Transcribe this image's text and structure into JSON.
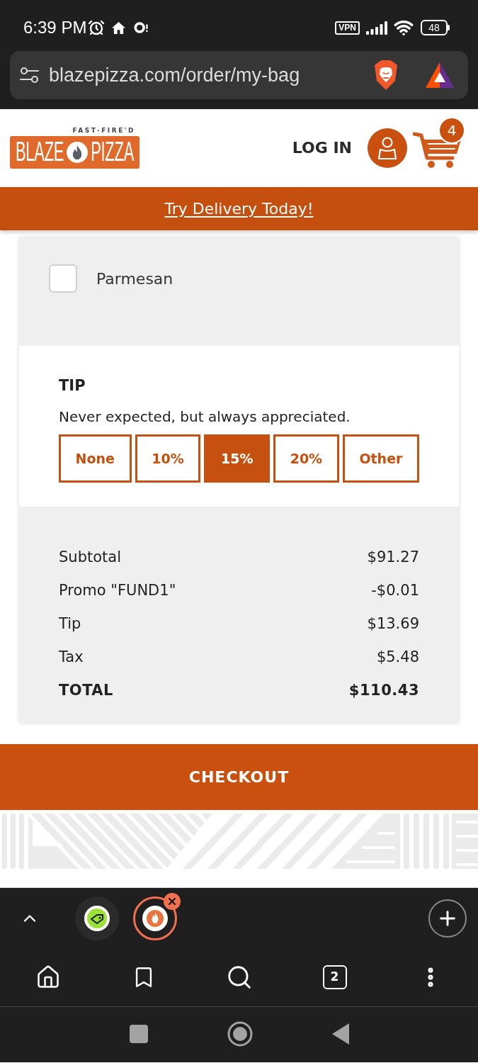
{
  "status_bar": {
    "time": "6:39 PM",
    "vpn_label": "VPN",
    "battery": "48"
  },
  "address_bar": {
    "url": "blazepizza.com/order/my-bag"
  },
  "header": {
    "logo": {
      "tagline": "FAST·FIRE'D",
      "word_left": "BLAZE",
      "word_right": "PIZZA"
    },
    "login": "LOG IN",
    "cart_count": "4"
  },
  "promo_banner": {
    "link": "Try Delivery Today!"
  },
  "toppings": [
    {
      "label": "Parmesan",
      "checked": false
    }
  ],
  "tip": {
    "title": "TIP",
    "subtitle": "Never expected, but always appreciated.",
    "options": [
      {
        "label": "None",
        "selected": false
      },
      {
        "label": "10%",
        "selected": false
      },
      {
        "label": "15%",
        "selected": true
      },
      {
        "label": "20%",
        "selected": false
      },
      {
        "label": "Other",
        "selected": false
      }
    ]
  },
  "summary": [
    {
      "kind": "line",
      "label": "Subtotal",
      "value": "$91.27"
    },
    {
      "kind": "line",
      "label": "Promo \"FUND1\"",
      "value": "-$0.01"
    },
    {
      "kind": "line",
      "label": "Tip",
      "value": "$13.69"
    },
    {
      "kind": "line",
      "label": "Tax",
      "value": "$5.48"
    },
    {
      "kind": "total",
      "label": "TOTAL",
      "value": "$110.43"
    }
  ],
  "checkout": {
    "label": "CHECKOUT"
  },
  "browser_toolbar": {
    "tabs": [
      {
        "selected": false
      },
      {
        "selected": true
      }
    ],
    "tab_count": "2"
  }
}
